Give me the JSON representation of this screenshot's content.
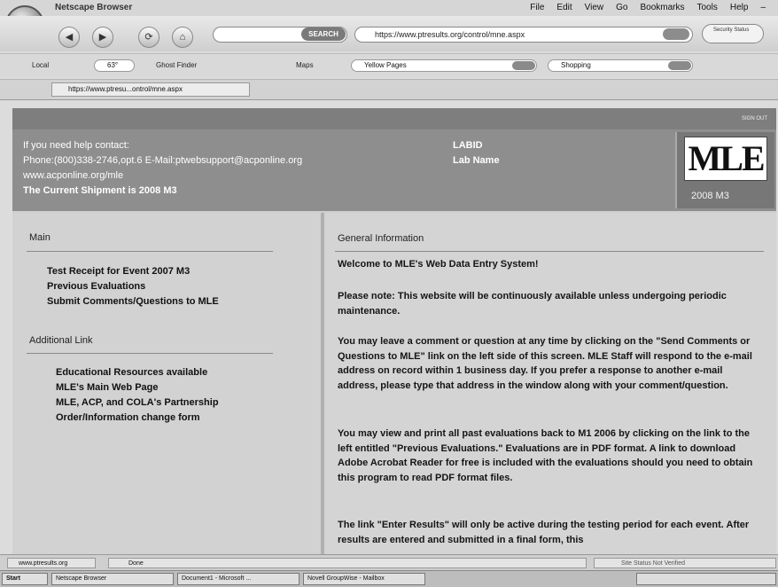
{
  "window": {
    "title": "Netscape Browser",
    "menu": [
      "File",
      "Edit",
      "View",
      "Go",
      "Bookmarks",
      "Tools",
      "Help"
    ]
  },
  "navbar": {
    "search_button": "SEARCH",
    "url": "https://www.ptresults.org/control/mne.aspx",
    "security_label": "Security Status"
  },
  "linksbar": {
    "local": "Local",
    "weather": "63°",
    "ghost_finder": "Ghost Finder",
    "maps": "Maps",
    "yellow_pages": "Yellow Pages",
    "shopping": "Shopping"
  },
  "tab": {
    "label": "https://www.ptresu...ontrol/mne.aspx"
  },
  "page": {
    "sign_out": "SIGN OUT",
    "help_line1": "If you need help contact:",
    "help_line2": "Phone:(800)338-2746,opt.6 E-Mail:ptwebsupport@acponline.org",
    "help_line3": "www.acponline.org/mle",
    "help_line4": "The Current Shipment is 2008 M3",
    "lab_id": "LABID",
    "lab_name": "Lab Name",
    "brand": "MLE",
    "shipment": "2008 M3"
  },
  "left": {
    "main_title": "Main",
    "main_links": [
      "Test Receipt for Event 2007 M3",
      "Previous Evaluations",
      "Submit Comments/Questions to MLE"
    ],
    "additional_title": "Additional Link",
    "additional_links": [
      "Educational Resources available",
      "MLE's Main Web Page",
      "MLE, ACP, and COLA's Partnership",
      "Order/Information change form"
    ]
  },
  "right": {
    "title": "General Information",
    "welcome": "Welcome to MLE's Web Data Entry System!",
    "p1": "Please note: This website will be continuously available unless undergoing periodic maintenance.",
    "p2": "You may leave a comment or question at any time by clicking on the \"Send Comments or Questions to MLE\" link on the left side of this screen. MLE Staff will respond to the e-mail address on record within 1 business day. If you prefer a response to another e-mail address, please type that address in the window along with your comment/question.",
    "p3": "You may view and print all past evaluations back to M1 2006 by clicking on the link to the left entitled \"Previous Evaluations.\" Evaluations are in PDF format. A link to download Adobe Acrobat Reader for free is included with the evaluations should you need to obtain this program to read PDF format files.",
    "p4": "The link \"Enter Results\" will only be active during the testing period for each event. After results are entered and submitted in a final form, this"
  },
  "statusbar": {
    "url": "www.ptresults.org",
    "done": "Done",
    "site": "Site Status Not Verified"
  },
  "taskbar": {
    "start": "Start",
    "tasks": [
      "Netscape Browser",
      "Document1 - Microsoft ...",
      "Novell GroupWise - Mailbox"
    ]
  }
}
